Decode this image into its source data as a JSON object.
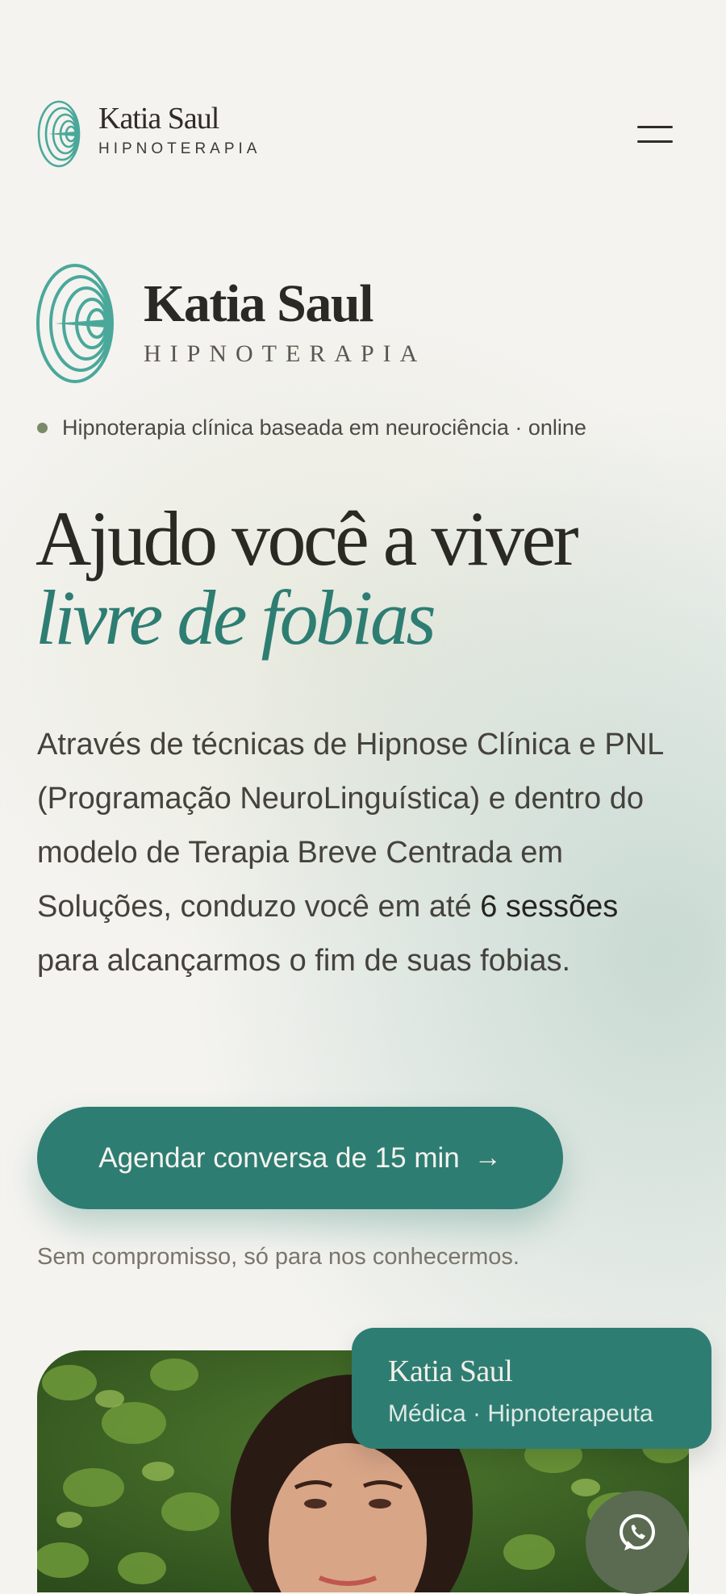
{
  "header": {
    "brand_name": "Katia Saul",
    "brand_sub": "HIPNOTERAPIA",
    "logo_icon": "spiral-logo-icon",
    "menu_icon": "hamburger-menu-icon"
  },
  "hero": {
    "brand_name": "Katia Saul",
    "brand_sub": "HIPNOTERAPIA",
    "badge": "Hipnoterapia clínica baseada em neurociência · online",
    "headline_line1": "Ajudo você a viver",
    "headline_line2": "livre de fobias",
    "description_before": "Através de técnicas de Hipnose Clínica e PNL (Programação NeuroLinguística) e dentro do modelo de Terapia Breve Centrada em Soluções, conduzo você em até ",
    "description_bold": "6 sessões",
    "description_after": " para alcançarmos o fim de suas fobias.",
    "cta_label": "Agendar conversa de 15 min",
    "cta_arrow": "→",
    "cta_note": "Sem compromisso, só para nos conhecermos."
  },
  "profile_card": {
    "name": "Katia Saul",
    "role": "Médica · Hipnoterapeuta"
  },
  "floating": {
    "whatsapp_icon": "whatsapp-icon"
  },
  "colors": {
    "accent": "#2e7d72",
    "text": "#2b2924",
    "background": "#f4f3ef",
    "badge_dot": "#7a8a68",
    "whatsapp_button": "#5b6b52"
  }
}
